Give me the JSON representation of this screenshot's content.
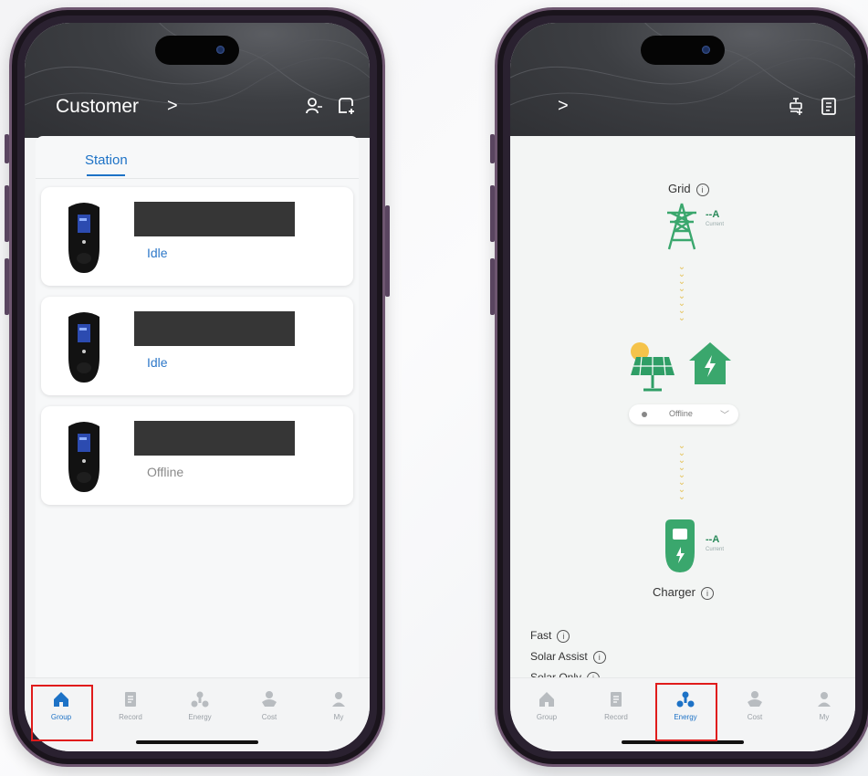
{
  "left_screen": {
    "header": {
      "title": "Customer",
      "chevron": ">",
      "user_icon": "user-icon",
      "add_icon": "add-charger-icon"
    },
    "tab": {
      "label": "Station"
    },
    "stations": [
      {
        "status": "Idle"
      },
      {
        "status": "Idle"
      },
      {
        "status": "Offline"
      }
    ],
    "tabbar": [
      {
        "label": "Group",
        "icon": "home-icon",
        "active": true
      },
      {
        "label": "Record",
        "icon": "record-icon",
        "active": false
      },
      {
        "label": "Energy",
        "icon": "energy-icon",
        "active": false
      },
      {
        "label": "Cost",
        "icon": "cost-icon",
        "active": false
      },
      {
        "label": "My",
        "icon": "profile-icon",
        "active": false
      }
    ]
  },
  "right_screen": {
    "header": {
      "chevron": ">",
      "settings_icon": "charger-settings-icon",
      "list_icon": "document-icon"
    },
    "energy": {
      "grid_label": "Grid",
      "grid_current": "--A",
      "grid_current_label": "Current",
      "solar_status": "Offline",
      "charger_label": "Charger",
      "charger_current": "--A",
      "charger_current_label": "Current"
    },
    "modes": [
      "Fast",
      "Solar Assist",
      "Solar Only"
    ],
    "tabbar": [
      {
        "label": "Group",
        "icon": "home-icon",
        "active": false
      },
      {
        "label": "Record",
        "icon": "record-icon",
        "active": false
      },
      {
        "label": "Energy",
        "icon": "energy-icon",
        "active": true
      },
      {
        "label": "Cost",
        "icon": "cost-icon",
        "active": false
      },
      {
        "label": "My",
        "icon": "profile-icon",
        "active": false
      }
    ]
  },
  "colors": {
    "accent": "#1d72c6",
    "highlight": "#e01b1b",
    "energy_green": "#3aa76d",
    "idle_blue": "#2e78c8"
  }
}
